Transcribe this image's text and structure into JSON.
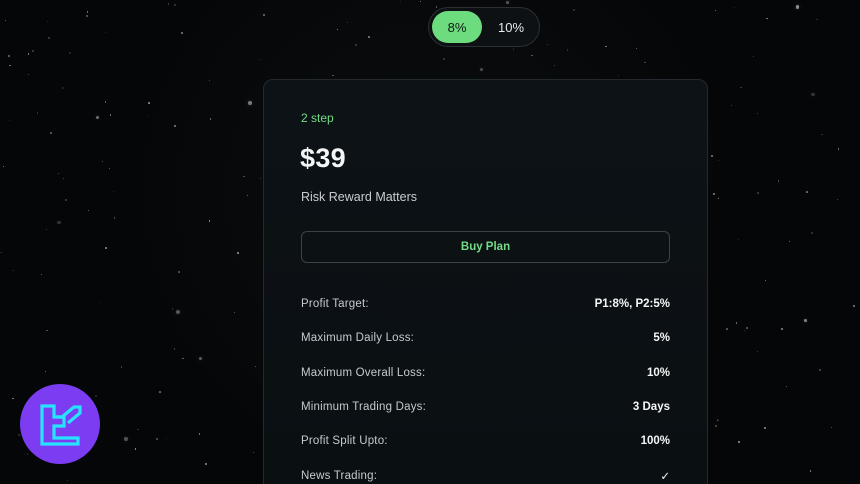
{
  "toggle": {
    "options": [
      {
        "label": "8%",
        "active": true
      },
      {
        "label": "10%",
        "active": false
      }
    ]
  },
  "plan": {
    "step": "2 step",
    "price": "$39",
    "subtitle": "Risk Reward Matters",
    "buy_label": "Buy Plan",
    "features": [
      {
        "label": "Profit Target:",
        "value": "P1:8%, P2:5%"
      },
      {
        "label": "Maximum Daily Loss:",
        "value": "5%"
      },
      {
        "label": "Maximum Overall Loss:",
        "value": "10%"
      },
      {
        "label": "Minimum Trading Days:",
        "value": "3 Days"
      },
      {
        "label": "Profit Split Upto:",
        "value": "100%"
      },
      {
        "label": "News Trading:",
        "value": "✓"
      }
    ]
  },
  "colors": {
    "accent_green": "#6cdc7f",
    "logo_purple": "#7b3cf2",
    "logo_cyan": "#27e3ff",
    "background": "#050607"
  },
  "icons": {
    "logo": "brand-logo-icon",
    "check": "check-icon"
  }
}
